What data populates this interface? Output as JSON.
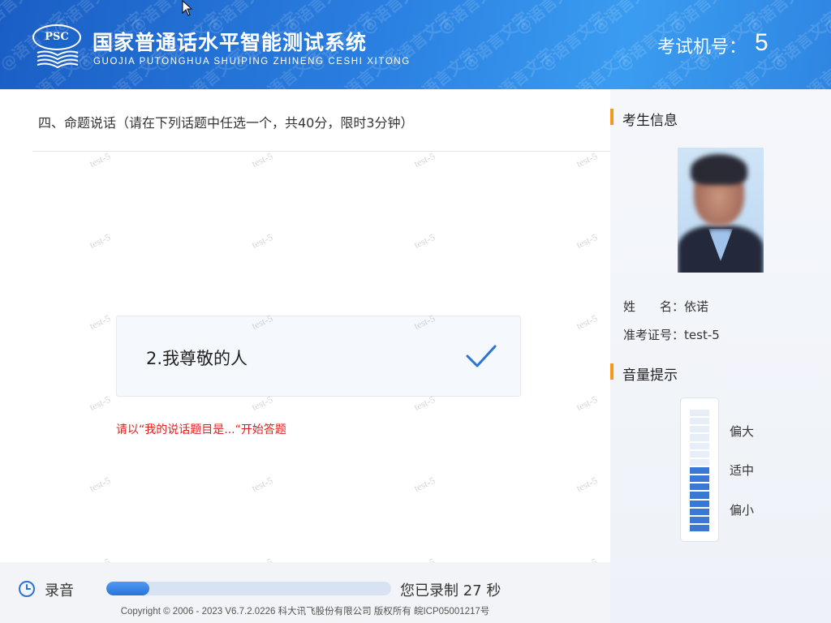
{
  "header": {
    "logo_text": "PSC",
    "title_cn": "国家普通话水平智能测试系统",
    "title_en": "GUOJIA PUTONGHUA SHUIPING ZHINENG CESHI XITONG",
    "seat_label": "考试机号：",
    "seat_number": "5",
    "watermark": "@语言文字"
  },
  "main": {
    "question_heading": "四、命题说话（请在下列话题中任选一个，共40分，限时3分钟）",
    "topic": "2.我尊敬的人",
    "topic_selected": true,
    "hint": "请以“我的说话题目是...“开始答题",
    "watermark": "test-5"
  },
  "recording": {
    "label": "录音",
    "progress_fraction": 0.15,
    "time_text": "您已录制 27 秒"
  },
  "footer": {
    "copyright": "Copyright © 2006 - 2023 V6.7.2.0226 科大讯飞股份有限公司 版权所有 皖ICP05001217号"
  },
  "sidebar": {
    "candidate_title": "考生信息",
    "name_label": "姓　　名：",
    "name_value": "依诺",
    "id_label": "准考证号：",
    "id_value": "test-5",
    "volume_title": "音量提示",
    "volume_levels": [
      "偏大",
      "适中",
      "偏小"
    ],
    "volume_total_cells": 15,
    "volume_active_cells": 8
  },
  "colors": {
    "header_blue": "#2a7fe0",
    "accent_orange": "#f39a1e",
    "check_blue": "#2a73d8",
    "hint_red": "#e02020",
    "meter_active": "#3a78d6"
  }
}
